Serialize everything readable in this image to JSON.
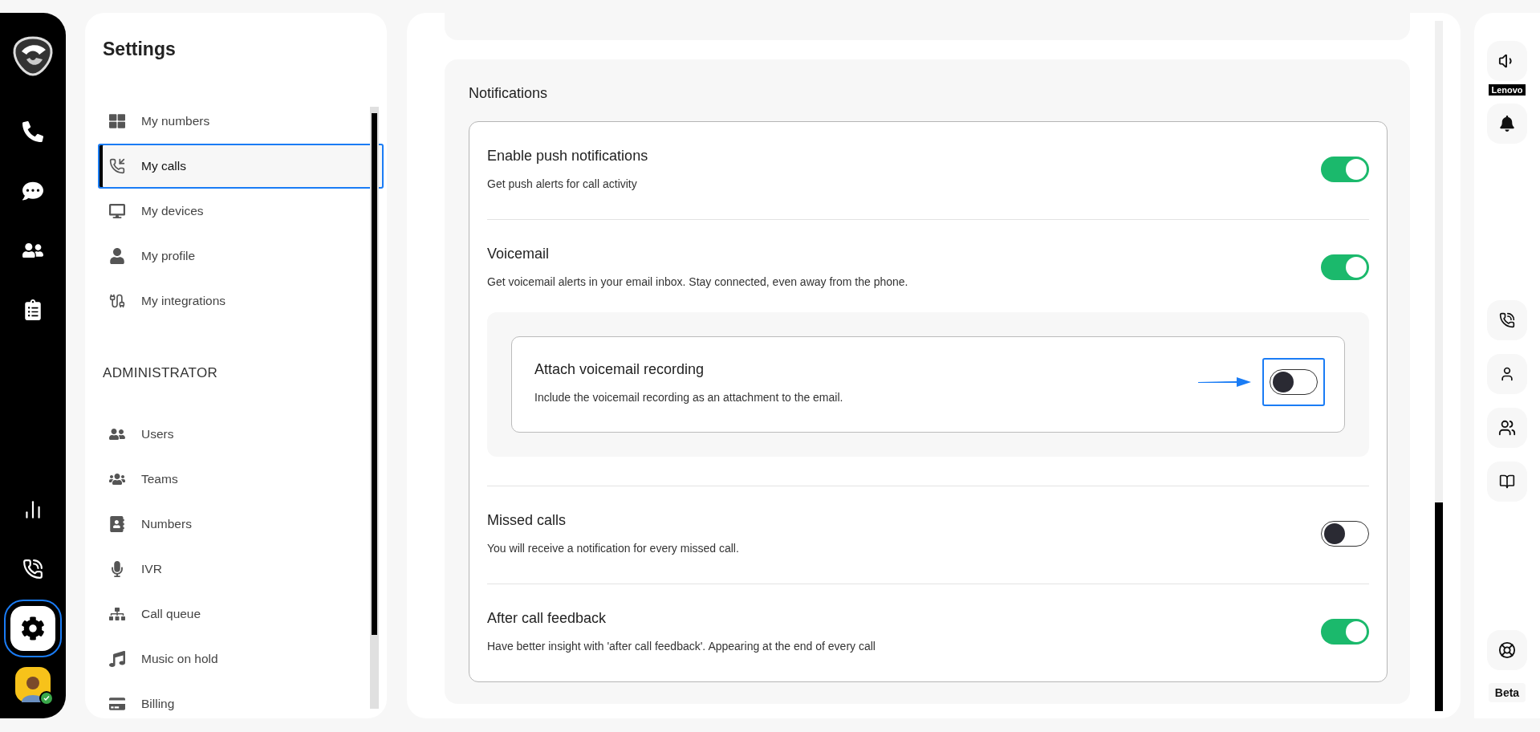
{
  "rail": {
    "items": [
      {
        "selected": false,
        "outlined": false
      },
      {
        "selected": false,
        "outlined": false
      },
      {
        "selected": false,
        "outlined": false
      },
      {
        "selected": false,
        "outlined": false
      },
      {
        "selected": false,
        "outlined": false
      },
      {
        "selected": false,
        "outlined": false
      },
      {
        "selected": true,
        "outlined": true
      }
    ],
    "user": {
      "online": true
    }
  },
  "sidebar": {
    "title": "Settings",
    "sections": [
      {
        "items": [
          {
            "label": "My numbers",
            "selected": false,
            "outlined": false
          },
          {
            "label": "My calls",
            "selected": true,
            "outlined": true
          },
          {
            "label": "My devices",
            "selected": false,
            "outlined": false
          },
          {
            "label": "My profile",
            "selected": false,
            "outlined": false
          },
          {
            "label": "My integrations",
            "selected": false,
            "outlined": false
          }
        ]
      },
      {
        "heading": "ADMINISTRATOR",
        "items": [
          {
            "label": "Users",
            "selected": false,
            "outlined": false
          },
          {
            "label": "Teams",
            "selected": false,
            "outlined": false
          },
          {
            "label": "Numbers",
            "selected": false,
            "outlined": false
          },
          {
            "label": "IVR",
            "selected": false,
            "outlined": false
          },
          {
            "label": "Call queue",
            "selected": false,
            "outlined": false
          },
          {
            "label": "Music on hold",
            "selected": false,
            "outlined": false
          },
          {
            "label": "Billing",
            "selected": false,
            "outlined": false
          }
        ]
      }
    ]
  },
  "notifications": {
    "title": "Notifications",
    "settings": [
      {
        "title": "Enable push notifications",
        "description": "Get push alerts for call activity",
        "on": true,
        "outlined": false
      },
      {
        "title": "Voicemail",
        "description": "Get voicemail alerts in your email inbox. Stay connected, even away from the phone.",
        "on": true,
        "outlined": false,
        "options": [
          {
            "title": "Attach voicemail recording",
            "description": "Include the voicemail recording as an attachment to the email.",
            "on": false,
            "outlined": true
          }
        ]
      },
      {
        "title": "Missed calls",
        "description": "You will receive a notification for every missed call.",
        "on": false,
        "outlined": false
      },
      {
        "title": "After call feedback",
        "description": "Have better insight with 'after call feedback'. Appearing at the end of every call",
        "on": true,
        "outlined": false
      }
    ]
  },
  "right_rail": {
    "device_label": "Lenovo",
    "beta_label": "Beta"
  }
}
